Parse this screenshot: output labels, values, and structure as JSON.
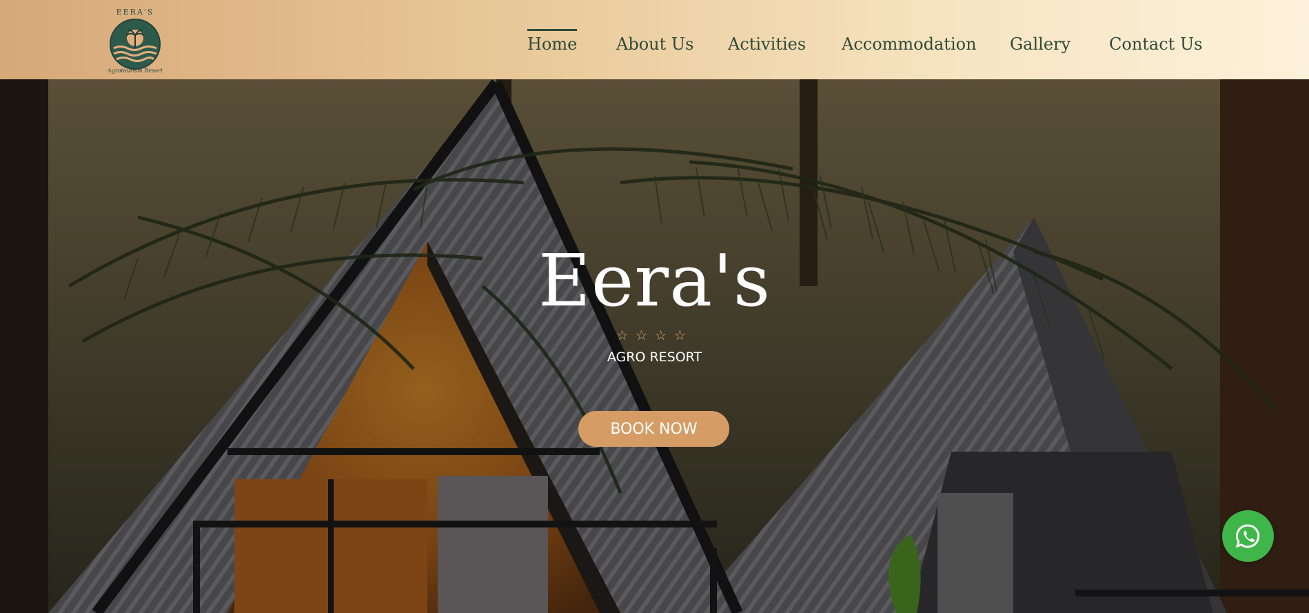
{
  "brand": {
    "name": "EERA'S",
    "tagline": "Agrotourism Resort"
  },
  "nav": {
    "items": [
      {
        "label": "Home",
        "active": true
      },
      {
        "label": "About Us",
        "active": false
      },
      {
        "label": "Activities",
        "active": false
      },
      {
        "label": "Accommodation",
        "active": false
      },
      {
        "label": "Gallery",
        "active": false
      },
      {
        "label": "Contact Us",
        "active": false
      }
    ]
  },
  "hero": {
    "title": "Eera's",
    "stars": "☆☆☆☆",
    "subtitle": "AGRO RESORT",
    "cta_label": "BOOK NOW"
  },
  "floating": {
    "icon": "whatsapp-icon"
  },
  "colors": {
    "nav_text": "#2f4a3a",
    "accent": "#d59d65",
    "whatsapp": "#3fb64a",
    "logo_green": "#2e5a4b"
  }
}
